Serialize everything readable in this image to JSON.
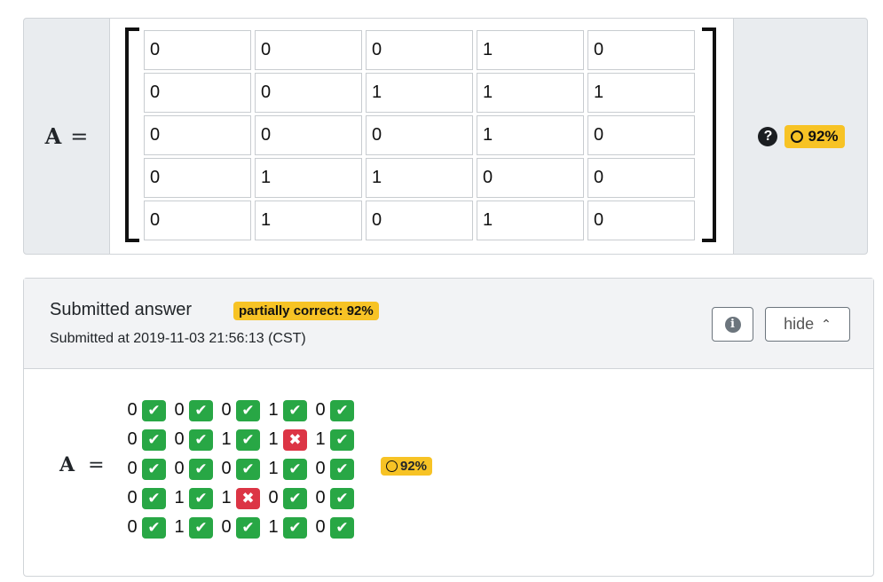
{
  "question": {
    "variable": "A",
    "equals": "=",
    "matrix": [
      [
        "0",
        "0",
        "0",
        "1",
        "0"
      ],
      [
        "0",
        "0",
        "1",
        "1",
        "1"
      ],
      [
        "0",
        "0",
        "0",
        "1",
        "0"
      ],
      [
        "0",
        "1",
        "1",
        "0",
        "0"
      ],
      [
        "0",
        "1",
        "0",
        "1",
        "0"
      ]
    ],
    "help_icon": "question-circle-icon",
    "score_label": "92%"
  },
  "submission": {
    "title": "Submitted answer",
    "badge": "partially correct: 92%",
    "submitted_at": "Submitted at 2019-11-03 21:56:13 (CST)",
    "info_icon": "info-circle-icon",
    "hide_label": "hide",
    "hide_icon": "chevron-up-icon",
    "variable": "A",
    "equals": "=",
    "rows": [
      [
        {
          "v": "0",
          "ok": true
        },
        {
          "v": "0",
          "ok": true
        },
        {
          "v": "0",
          "ok": true
        },
        {
          "v": "1",
          "ok": true
        },
        {
          "v": "0",
          "ok": true
        }
      ],
      [
        {
          "v": "0",
          "ok": true
        },
        {
          "v": "0",
          "ok": true
        },
        {
          "v": "1",
          "ok": true
        },
        {
          "v": "1",
          "ok": false
        },
        {
          "v": "1",
          "ok": true
        }
      ],
      [
        {
          "v": "0",
          "ok": true
        },
        {
          "v": "0",
          "ok": true
        },
        {
          "v": "0",
          "ok": true
        },
        {
          "v": "1",
          "ok": true
        },
        {
          "v": "0",
          "ok": true
        }
      ],
      [
        {
          "v": "0",
          "ok": true
        },
        {
          "v": "1",
          "ok": true
        },
        {
          "v": "1",
          "ok": false
        },
        {
          "v": "0",
          "ok": true
        },
        {
          "v": "0",
          "ok": true
        }
      ],
      [
        {
          "v": "0",
          "ok": true
        },
        {
          "v": "1",
          "ok": true
        },
        {
          "v": "0",
          "ok": true
        },
        {
          "v": "1",
          "ok": true
        },
        {
          "v": "0",
          "ok": true
        }
      ]
    ],
    "score_label": "92%"
  },
  "colors": {
    "score_badge": "#f7c325",
    "correct": "#28a745",
    "incorrect": "#dc3545"
  }
}
